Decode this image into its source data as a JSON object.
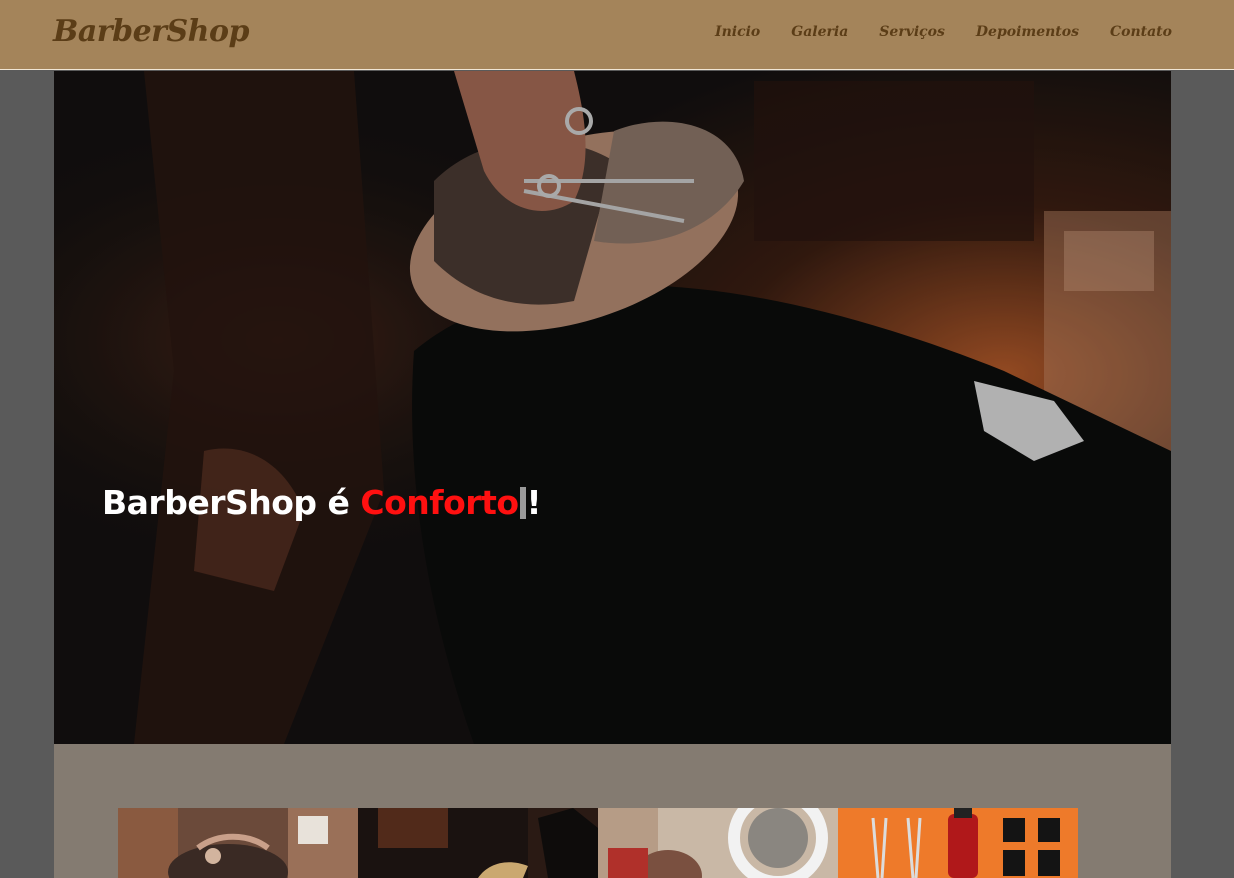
{
  "brand": {
    "name": "BarberShop",
    "color": "#5b3d17",
    "header_bg": "#a4845a"
  },
  "nav": {
    "items": [
      {
        "label": "Inicio",
        "icon": null
      },
      {
        "label": "Galeria",
        "icon": null
      },
      {
        "label": "Serviços",
        "icon": null
      },
      {
        "label": "Depoimentos",
        "icon": null
      },
      {
        "label": "Contato",
        "icon": null
      }
    ]
  },
  "hero": {
    "title_prefix": "BarberShop é ",
    "title_highlight": "Conforto",
    "title_suffix": "!",
    "highlight_color": "#ff1010",
    "image": "man-reclined-in-barber-chair-getting-beard-trimmed-with-scissors"
  },
  "gallery": {
    "background": "#847b71",
    "images": [
      "barber-cutting-client-hair",
      "barber-using-clippers",
      "client-with-ring-light",
      "scissors-and-combs-on-orange"
    ]
  }
}
